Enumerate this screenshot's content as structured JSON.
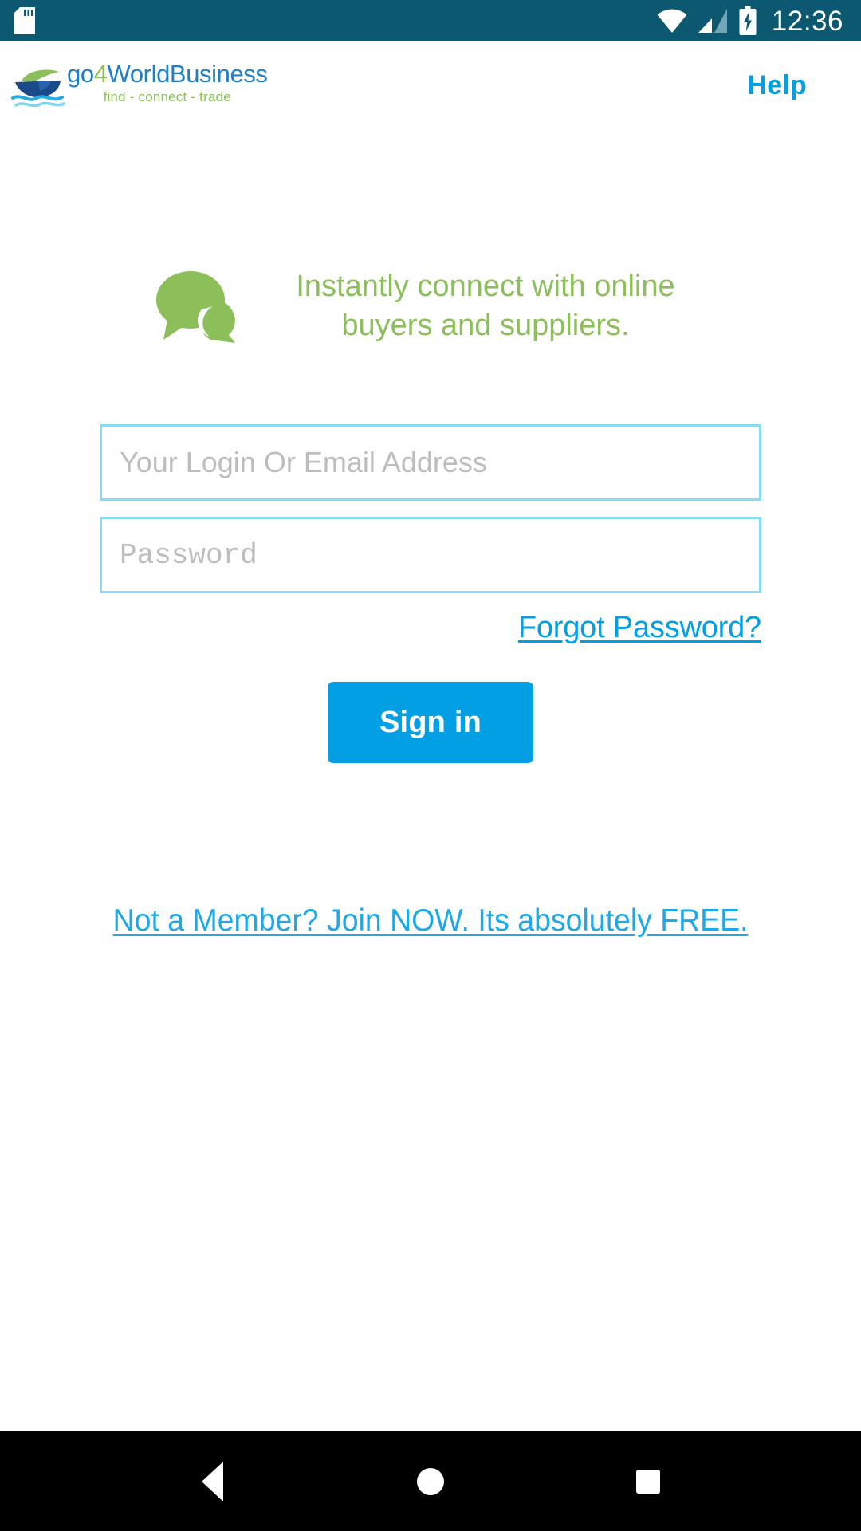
{
  "status_bar": {
    "time": "12:36",
    "icons": [
      "sd-card-icon",
      "wifi-icon",
      "cellular-signal-icon",
      "battery-charging-icon"
    ],
    "background_color": "#0b5870"
  },
  "header": {
    "brand_name_part1": "go",
    "brand_name_accent": "4",
    "brand_name_part2": "WorldBusiness",
    "brand_tagline": "find - connect - trade",
    "help_label": "Help",
    "help_color": "#00a0e8",
    "brand_blue": "#1f7fc4",
    "brand_green": "#8cbf5a"
  },
  "promo": {
    "text": "Instantly connect with online buyers and suppliers.",
    "icon": "chat-bubbles-icon",
    "color": "#8cbf5a"
  },
  "form": {
    "email_placeholder": "Your Login Or Email Address",
    "email_value": "",
    "password_placeholder": "Password",
    "password_value": "",
    "forgot_password_label": "Forgot Password?",
    "signin_label": "Sign in",
    "field_border_color": "#87dbf2",
    "button_color": "#029fe5",
    "link_color": "#00a0e8"
  },
  "footer": {
    "join_label": "Not a Member? Join NOW. Its absolutely FREE.",
    "join_color": "#1fa8e8"
  },
  "nav_bar": {
    "back_label": "Back",
    "home_label": "Home",
    "recents_label": "Recents",
    "background_color": "#000000"
  }
}
